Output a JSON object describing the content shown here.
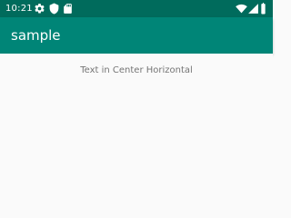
{
  "status_bar": {
    "time": "10:21",
    "left_icons": [
      "gear-icon",
      "shield-icon",
      "sd-card-icon"
    ],
    "right_icons": [
      "wifi-icon",
      "cellular-signal-icon",
      "battery-icon"
    ],
    "background_color": "#006b5c"
  },
  "app_bar": {
    "title": "sample",
    "background_color": "#008577"
  },
  "content": {
    "center_text": "Text in Center Horizontal",
    "text_color": "#757575",
    "background_color": "#fafafa"
  }
}
